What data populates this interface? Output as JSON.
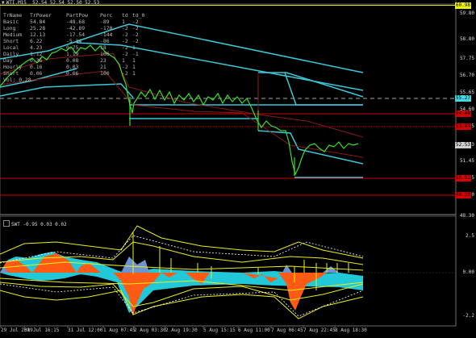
{
  "title_line": {
    "symbol": "WTI.M15",
    "ohlc": "52.54 52.54 52.50 52.53"
  },
  "stats_table": {
    "headers": [
      "TrName",
      "TrPower",
      "PartPow",
      "Perc",
      "td",
      "td_0"
    ],
    "rows": [
      [
        "Basic",
        "54.84",
        "-48.68",
        "-89",
        "1",
        "-2"
      ],
      [
        "Long",
        "25.28",
        "-42.89",
        "-170",
        "-2",
        "-2"
      ],
      [
        "Medium",
        "12.13",
        "-17.54",
        "-144",
        "-2",
        "-2"
      ],
      [
        "Short",
        "6.22",
        "-5.34",
        "-86",
        "-2",
        "-2"
      ],
      [
        "Local",
        "4.23",
        "0.75",
        "18",
        "-2",
        "1"
      ],
      [
        "Daily",
        "1.12",
        "1.19",
        "106",
        "-2",
        "-1"
      ],
      [
        "Day",
        "0.36",
        "0.08",
        "23",
        "1",
        "1"
      ],
      [
        "Hourly",
        "0.16",
        "0.03",
        "21",
        "-2",
        "1"
      ],
      [
        "Short",
        "0.06",
        "0.06",
        "100",
        "-2",
        "1"
      ]
    ],
    "vol": "Vol: 0.28"
  },
  "price_axis": {
    "labels": [
      "59.80",
      "58.80",
      "57.75",
      "56.70",
      "55.65",
      "54.60",
      "53.55",
      "52.53",
      "51.45",
      "50.35",
      "49.30",
      "48.30"
    ],
    "tags": [
      {
        "text": "60.98",
        "color": "#e8f20a"
      },
      {
        "text": "55.27",
        "color": "#46d7e0"
      },
      {
        "text": "54.40",
        "color": "#d60000"
      },
      {
        "text": "53.83",
        "color": "#d60000"
      },
      {
        "text": "52.53",
        "color": "#cfcfcf"
      },
      {
        "text": "50.51",
        "color": "#d60000"
      },
      {
        "text": "49.30",
        "color": "#d60000"
      }
    ]
  },
  "sub_window": {
    "title": "SWT -0.95 0.03 0.02",
    "axis_labels": [
      "2.5",
      "0.00",
      "-2.2"
    ]
  },
  "time_axis": [
    "29 Jul 2019",
    "30 Jul 16:15",
    "31 Jul 12:00",
    "1 Aug 07:45",
    "2 Aug 03:30",
    "2 Aug 19:30",
    "5 Aug 15:15",
    "6 Aug 11:00",
    "7 Aug 06:45",
    "7 Aug 22:45",
    "8 Aug 18:30"
  ],
  "colors": {
    "background": "#000000",
    "price_line": "#39e027",
    "channel": "#3ac7d6",
    "level": "#cc0000",
    "ma_dark": "#8b1a1a",
    "orange": "#ff5a14",
    "cyan_fill": "#20c8d8",
    "yellow": "#e9ef1a",
    "blue_fill": "#6d94d1"
  }
}
